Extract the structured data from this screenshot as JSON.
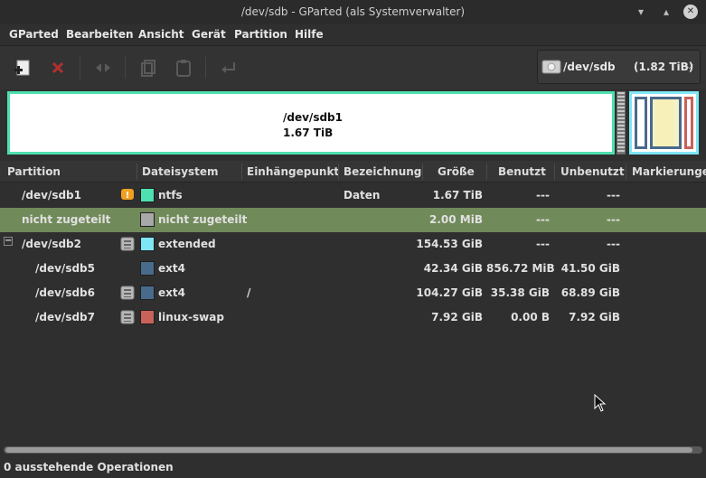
{
  "window": {
    "title": "/dev/sdb - GParted (als Systemverwalter)"
  },
  "menu": {
    "items": [
      "GParted",
      "Bearbeiten",
      "Ansicht",
      "Gerät",
      "Partition",
      "Hilfe"
    ]
  },
  "toolbar": {
    "buttons": [
      "new-partition",
      "delete-partition",
      "resize-move",
      "copy",
      "paste",
      "undo"
    ],
    "device": "/dev/sdb",
    "device_size": "(1.82 TiB)"
  },
  "graph": {
    "selected_partition": "/dev/sdb1",
    "selected_size": "1.67 TiB"
  },
  "table": {
    "columns": [
      "Partition",
      "Dateisystem",
      "Einhängepunkt",
      "Bezeichnung",
      "Größe",
      "Benutzt",
      "Unbenutzt",
      "Markierungen"
    ],
    "rows": [
      {
        "partition": "/dev/sdb1",
        "fs": "ntfs",
        "fs_color": "#4ee0b0",
        "mount": "",
        "label": "Daten",
        "size": "1.67 TiB",
        "used": "---",
        "unused": "---",
        "flag": "warning"
      },
      {
        "partition": "nicht zugeteilt",
        "fs": "nicht zugeteilt",
        "fs_color": "#a8a8a8",
        "mount": "",
        "label": "",
        "size": "2.00 MiB",
        "used": "---",
        "unused": "---",
        "flag": ""
      },
      {
        "partition": "/dev/sdb2",
        "fs": "extended",
        "fs_color": "#7fe6f5",
        "mount": "",
        "label": "",
        "size": "154.53 GiB",
        "used": "---",
        "unused": "---",
        "flag": "info"
      },
      {
        "partition": "/dev/sdb5",
        "fs": "ext4",
        "fs_color": "#4a6a8c",
        "mount": "",
        "label": "",
        "size": "42.34 GiB",
        "used": "856.72 MiB",
        "unused": "41.50 GiB",
        "flag": ""
      },
      {
        "partition": "/dev/sdb6",
        "fs": "ext4",
        "fs_color": "#4a6a8c",
        "mount": "/",
        "label": "",
        "size": "104.27 GiB",
        "used": "35.38 GiB",
        "unused": "68.89 GiB",
        "flag": "info"
      },
      {
        "partition": "/dev/sdb7",
        "fs": "linux-swap",
        "fs_color": "#c8625a",
        "mount": "",
        "label": "",
        "size": "7.92 GiB",
        "used": "0.00 B",
        "unused": "7.92 GiB",
        "flag": "info"
      }
    ]
  },
  "tree": {
    "collapse": "−"
  },
  "status": {
    "text": "0 ausstehende Operationen"
  }
}
